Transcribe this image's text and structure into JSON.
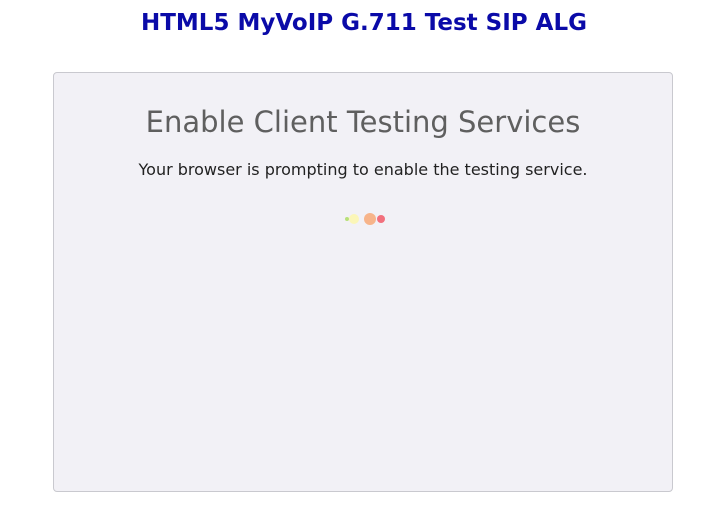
{
  "header": {
    "title": "HTML5 MyVoIP G.711 Test SIP ALG"
  },
  "panel": {
    "heading": "Enable Client Testing Services",
    "message": "Your browser is prompting to enable the testing service."
  },
  "loader": {
    "label": "loading-indicator",
    "dots": [
      {
        "color": "#b8e07a"
      },
      {
        "color": "#fbf6b8"
      },
      {
        "color": "#f7b48a"
      },
      {
        "color": "#f2707d"
      }
    ]
  },
  "colors": {
    "title": "#0a0aa8",
    "panel_bg": "#f2f1f6",
    "panel_border": "#c9c9cf",
    "heading": "#5f5f5f",
    "text": "#222222"
  }
}
